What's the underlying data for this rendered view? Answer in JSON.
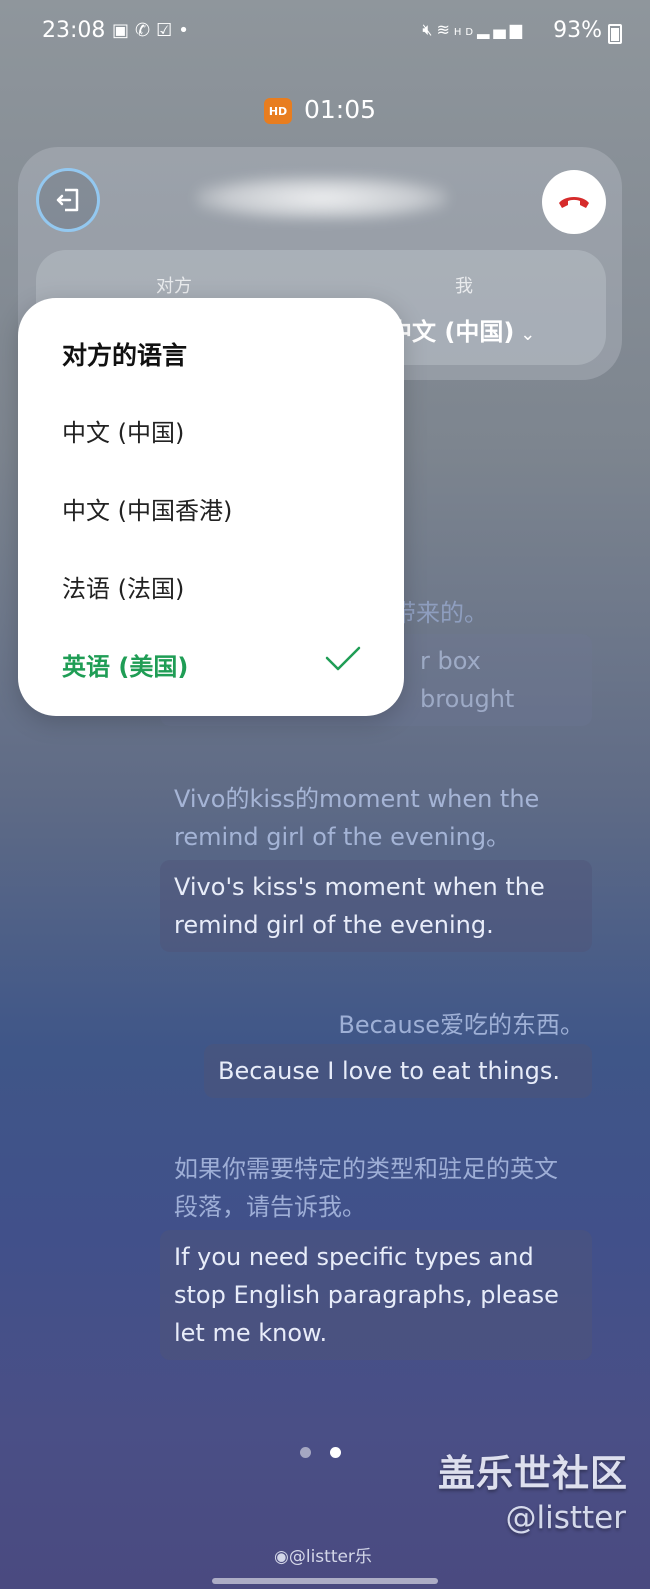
{
  "status_bar": {
    "time": "23:08",
    "left_icons": [
      "gallery-icon",
      "phone-icon",
      "check-app-icon",
      "dot-icon"
    ],
    "right_icons": [
      "mute-icon",
      "wifi-calling-icon",
      "hd-icon",
      "signal-5g-icon"
    ],
    "battery": "93%"
  },
  "call": {
    "hd_badge": "HD",
    "duration": "01:05",
    "exit_icon": "exit-icon",
    "hangup_icon": "hangup-icon",
    "hangup_color": "#d62b2b"
  },
  "language_panel": {
    "other_label": "对方",
    "me_label": "我",
    "me_language": "中文 (中国)"
  },
  "dropdown": {
    "title": "对方的语言",
    "items": [
      {
        "label": "中文 (中国)",
        "selected": false
      },
      {
        "label": "中文 (中国香港)",
        "selected": false
      },
      {
        "label": "法语 (法国)",
        "selected": false
      },
      {
        "label": "英语 (美国)",
        "selected": true
      }
    ],
    "selected_color": "#1f9d55"
  },
  "transcript": [
    {
      "source": "的安全带来的。",
      "translation": "r box brought"
    },
    {
      "source": "Vivo的kiss的moment when the remind girl of the evening。",
      "translation": "Vivo's kiss's moment when the remind girl of the evening."
    },
    {
      "source": "Because爱吃的东西。",
      "translation": "Because I love to eat things."
    },
    {
      "source": "如果你需要特定的类型和驻足的英文段落，请告诉我。",
      "translation": "If you need specific types and stop English paragraphs, please let me know."
    }
  ],
  "pager": {
    "count": 2,
    "active": 2
  },
  "watermark": {
    "site": "盖乐世社区",
    "handle": "@listter",
    "weibo": "@listter乐"
  }
}
